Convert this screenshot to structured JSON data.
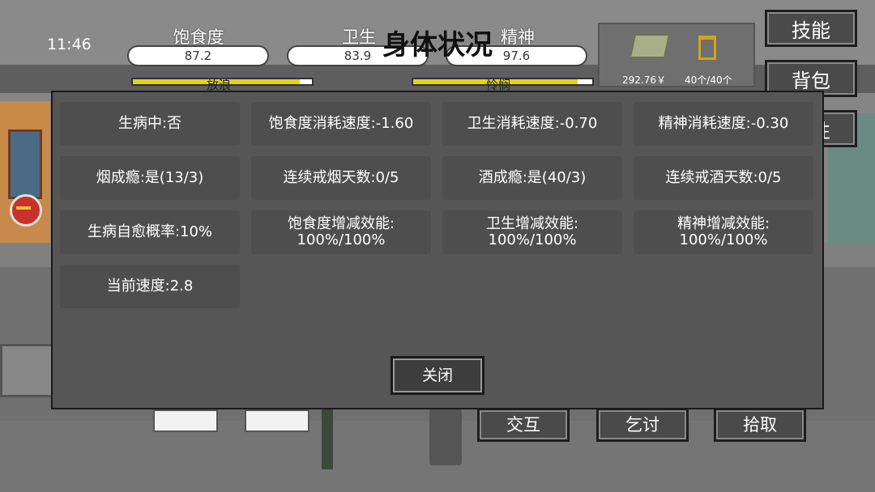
{
  "hud": {
    "time": "11:46",
    "stats": [
      {
        "label": "饱食度",
        "value": "87.2",
        "fraction": 0.872
      },
      {
        "label": "卫生",
        "value": "83.9",
        "fraction": 0.839
      },
      {
        "label": "精神",
        "value": "97.6",
        "fraction": 0.976
      }
    ],
    "mini_bars": [
      {
        "caption": "放浪",
        "fraction": 0.93
      },
      {
        "caption": "怜悯",
        "fraction": 0.92
      }
    ],
    "money": "292.76￥",
    "inventory": "40个/40个"
  },
  "side_buttons": [
    "技能",
    "背包",
    "属性"
  ],
  "bottom_buttons": [
    "交互",
    "乞讨",
    "拾取"
  ],
  "dialog": {
    "title": "身体状况",
    "cells": [
      "生病中:否",
      "饱食度消耗速度:-1.60",
      "卫生消耗速度:-0.70",
      "精神消耗速度:-0.30",
      "烟成瘾:是(13/3)",
      "连续戒烟天数:0/5",
      "酒成瘾:是(40/3)",
      "连续戒酒天数:0/5",
      "生病自愈概率:10%",
      "饱食度增减效能:\n100%/100%",
      "卫生增减效能:\n100%/100%",
      "精神增减效能:\n100%/100%",
      "当前速度:2.8"
    ],
    "close_label": "关闭"
  },
  "colors": {
    "accent_yellow": "#e6d31a",
    "panel": "#565656"
  }
}
